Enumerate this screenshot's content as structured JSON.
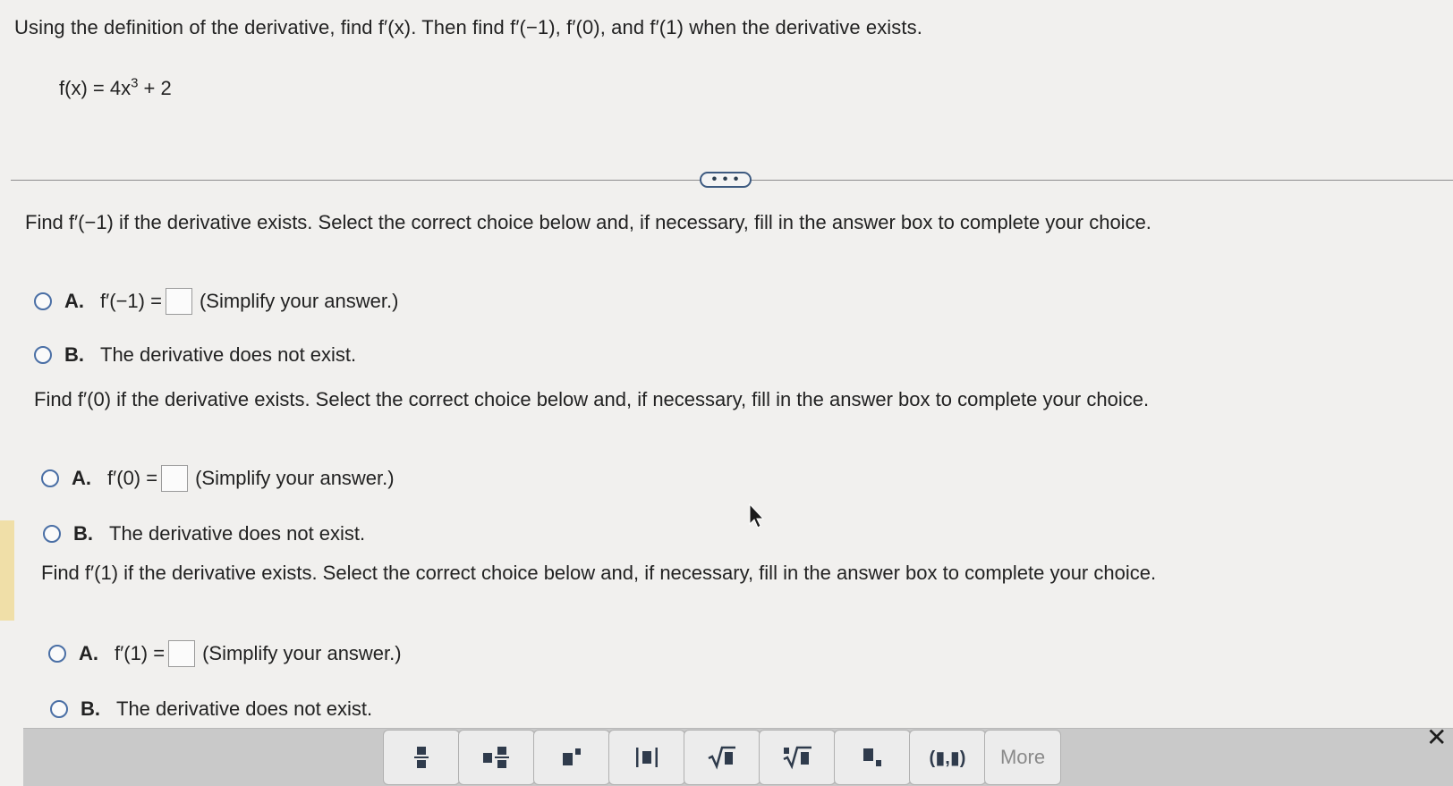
{
  "question": {
    "instruction": "Using the definition of the derivative, find f′(x). Then find f′(−1), f′(0), and f′(1) when the derivative exists.",
    "function_prefix": "f(x) = 4x",
    "function_exponent": "3",
    "function_suffix": " + 2"
  },
  "expand_button": {
    "label": "• • •"
  },
  "parts": [
    {
      "prompt": "Find f′(−1) if the derivative exists. Select the correct choice below and, if necessary, fill in the answer box to complete your choice.",
      "option_a_letter": "A.",
      "option_a_lhs": "f′(−1) =",
      "option_a_hint": "(Simplify your answer.)",
      "option_b_letter": "B.",
      "option_b_text": "The derivative does not exist."
    },
    {
      "prompt": "Find f′(0) if the derivative exists. Select the correct choice below and, if necessary, fill in the answer box to complete your choice.",
      "option_a_letter": "A.",
      "option_a_lhs": "f′(0) =",
      "option_a_hint": "(Simplify your answer.)",
      "option_b_letter": "B.",
      "option_b_text": "The derivative does not exist."
    },
    {
      "prompt": "Find f′(1) if the derivative exists. Select the correct choice below and, if necessary, fill in the answer box to complete your choice.",
      "option_a_letter": "A.",
      "option_a_lhs": "f′(1) =",
      "option_a_hint": "(Simplify your answer.)",
      "option_b_letter": "B.",
      "option_b_text": "The derivative does not exist."
    }
  ],
  "toolbar": {
    "tools": [
      "fraction-icon",
      "mixed-number-icon",
      "exponent-icon",
      "absolute-value-icon",
      "square-root-icon",
      "nth-root-icon",
      "subscript-icon",
      "ordered-pair-icon"
    ],
    "ordered_pair_label": "(▮,▮)",
    "more_label": "More",
    "close_label": "✕"
  },
  "colors": {
    "radio_border": "#4a6fa5",
    "accent_bar": "#f0dfa8",
    "toolbar_bg": "#c9c9c9"
  }
}
